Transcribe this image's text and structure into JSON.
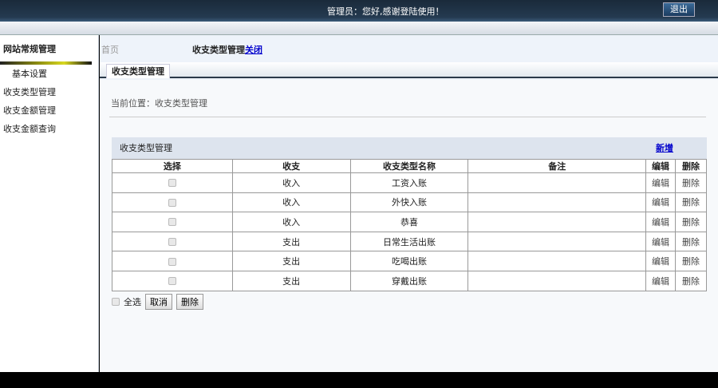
{
  "header": {
    "welcome": "管理员：您好,感谢登陆使用！",
    "logout": "退出"
  },
  "sidebar": {
    "title": "网站常规管理",
    "items": [
      "基本设置",
      "收支类型管理",
      "收支金额管理",
      "收支金额查询"
    ]
  },
  "breadcrumb": {
    "home": "首页",
    "current": "收支类型管理",
    "close": "关闭"
  },
  "tab": "收支类型管理",
  "position": "当前位置：收支类型管理",
  "box": {
    "title": "收支类型管理",
    "add": "新增"
  },
  "table": {
    "headers": [
      "选择",
      "收支",
      "收支类型名称",
      "备注",
      "编辑",
      "删除"
    ],
    "rows": [
      {
        "kind": "收入",
        "name": "工资入账",
        "note": "",
        "edit": "编辑",
        "del": "删除"
      },
      {
        "kind": "收入",
        "name": "外快入账",
        "note": "",
        "edit": "编辑",
        "del": "删除"
      },
      {
        "kind": "收入",
        "name": "恭喜",
        "note": "",
        "edit": "编辑",
        "del": "删除"
      },
      {
        "kind": "支出",
        "name": "日常生活出账",
        "note": "",
        "edit": "编辑",
        "del": "删除"
      },
      {
        "kind": "支出",
        "name": "吃喝出账",
        "note": "",
        "edit": "编辑",
        "del": "删除"
      },
      {
        "kind": "支出",
        "name": "穿戴出账",
        "note": "",
        "edit": "编辑",
        "del": "删除"
      }
    ]
  },
  "footer": {
    "select_all": "全选",
    "cancel": "取消",
    "delete": "删除"
  }
}
